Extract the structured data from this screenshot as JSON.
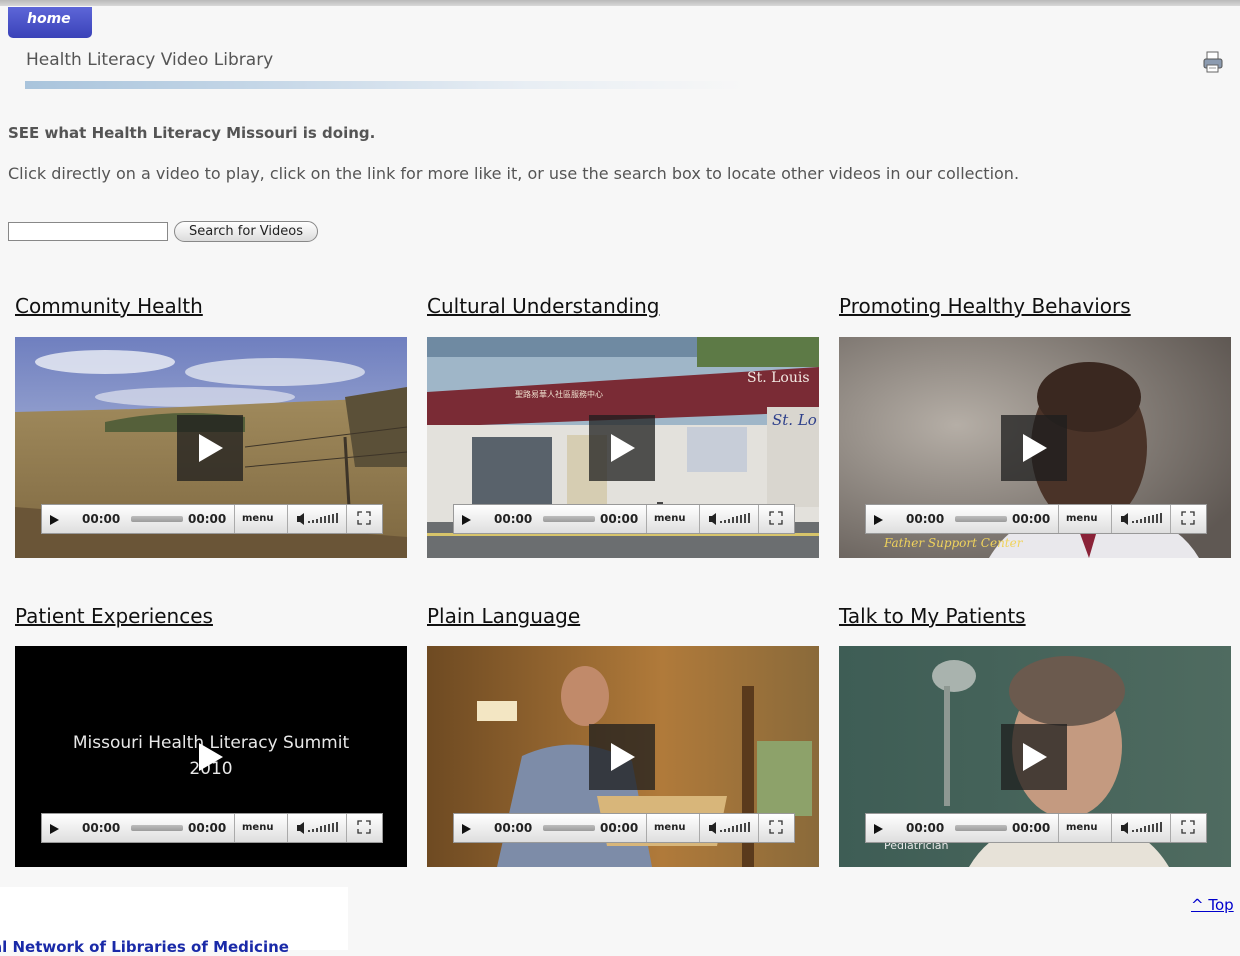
{
  "nav": {
    "home_label": "home"
  },
  "header": {
    "title": "Health Literacy Video Library",
    "print_icon": "printer-icon"
  },
  "intro": {
    "heading": "SEE what Health Literacy Missouri is doing.",
    "text": "Click directly on a video to play, click on the link for more like it, or use the search box to locate other videos in our collection."
  },
  "search": {
    "value": "",
    "placeholder": "",
    "button_label": "Search for Videos"
  },
  "videos": [
    {
      "title": "Community Health",
      "current_time": "00:00",
      "duration": "00:00",
      "menu_label": "menu",
      "overlay_text": ""
    },
    {
      "title": "Cultural Understanding",
      "current_time": "00:00",
      "duration": "00:00",
      "menu_label": "menu",
      "overlay_text": "St. Louis",
      "sign_text": "St. Lo",
      "banner_text": "聖路易華人社區服務中心"
    },
    {
      "title": "Promoting Healthy Behaviors",
      "current_time": "00:00",
      "duration": "00:00",
      "menu_label": "menu",
      "overlay_text": "Father Support Center"
    },
    {
      "title": "Patient Experiences",
      "current_time": "00:00",
      "duration": "00:00",
      "menu_label": "menu",
      "overlay_text": "Missouri Health Literacy Summit",
      "overlay_text_2": "2010"
    },
    {
      "title": "Plain Language",
      "current_time": "00:00",
      "duration": "00:00",
      "menu_label": "menu",
      "overlay_text": ""
    },
    {
      "title": "Talk to My Patients",
      "current_time": "00:00",
      "duration": "00:00",
      "menu_label": "menu",
      "overlay_text": "Pediatrician"
    }
  ],
  "footer": {
    "top_link": "^ Top",
    "network_text": "al Network of Libraries of Medicine"
  },
  "colors": {
    "accent": "#4a52c8",
    "link": "#0000cc",
    "text": "#555555"
  }
}
